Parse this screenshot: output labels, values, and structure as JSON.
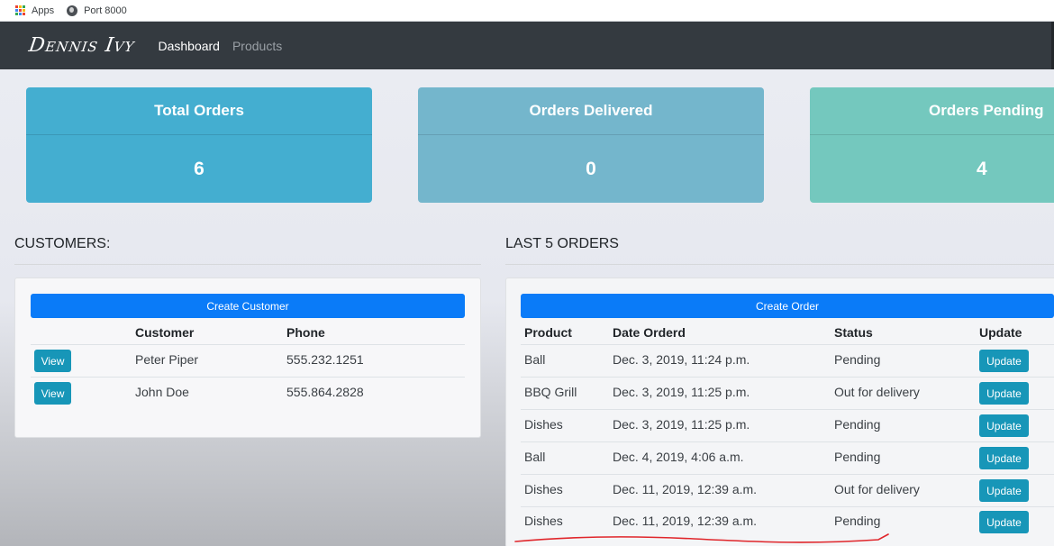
{
  "bookmarks": {
    "items": [
      {
        "label": "Apps",
        "icon": "apps-grid-icon"
      },
      {
        "label": "Port 8000",
        "icon": "globe-icon"
      }
    ]
  },
  "navbar": {
    "brand": "Dennis Ivy",
    "links": [
      {
        "label": "Dashboard",
        "active": true
      },
      {
        "label": "Products",
        "active": false
      }
    ]
  },
  "stats": [
    {
      "title": "Total Orders",
      "value": "6",
      "color": "#44aed0"
    },
    {
      "title": "Orders Delivered",
      "value": "0",
      "color": "#74b6cc"
    },
    {
      "title": "Orders Pending",
      "value": "4",
      "color": "#74c8be"
    }
  ],
  "customers": {
    "heading": "CUSTOMERS:",
    "create_label": "Create Customer",
    "columns": [
      "",
      "Customer",
      "Phone"
    ],
    "rows": [
      {
        "action": "View",
        "name": "Peter Piper",
        "phone": "555.232.1251"
      },
      {
        "action": "View",
        "name": "John Doe",
        "phone": "555.864.2828"
      }
    ]
  },
  "orders": {
    "heading": "LAST 5 ORDERS",
    "create_label": "Create Order",
    "columns": [
      "Product",
      "Date Orderd",
      "Status",
      "Update"
    ],
    "rows": [
      {
        "product": "Ball",
        "date": "Dec. 3, 2019, 11:24 p.m.",
        "status": "Pending",
        "action": "Update"
      },
      {
        "product": "BBQ Grill",
        "date": "Dec. 3, 2019, 11:25 p.m.",
        "status": "Out for delivery",
        "action": "Update"
      },
      {
        "product": "Dishes",
        "date": "Dec. 3, 2019, 11:25 p.m.",
        "status": "Pending",
        "action": "Update"
      },
      {
        "product": "Ball",
        "date": "Dec. 4, 2019, 4:06 a.m.",
        "status": "Pending",
        "action": "Update"
      },
      {
        "product": "Dishes",
        "date": "Dec. 11, 2019, 12:39 a.m.",
        "status": "Out for delivery",
        "action": "Update"
      },
      {
        "product": "Dishes",
        "date": "Dec. 11, 2019, 12:39 a.m.",
        "status": "Pending",
        "action": "Update"
      }
    ]
  },
  "colors": {
    "navbar": "#343a40",
    "primary": "#0a7bf8",
    "info": "#1796b8",
    "annotation": "#e0262b"
  }
}
